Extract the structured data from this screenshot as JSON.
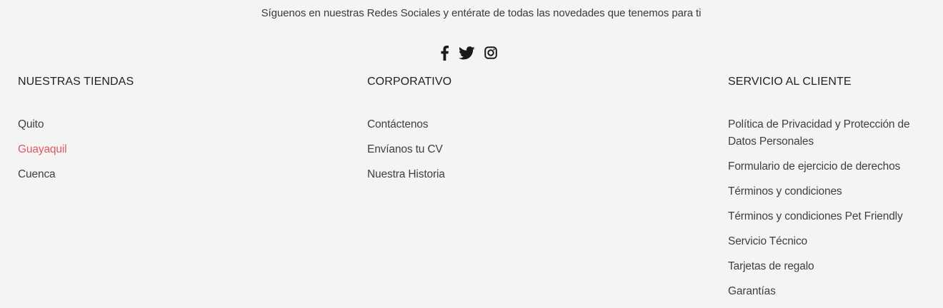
{
  "follow_text": "Síguenos en nuestras Redes Sociales y entérate de todas las novedades que tenemos para ti",
  "social": [
    {
      "icon": "facebook-icon"
    },
    {
      "icon": "twitter-icon"
    },
    {
      "icon": "instagram-icon"
    }
  ],
  "columns": {
    "tiendas": {
      "title": "NUESTRAS TIENDAS",
      "items": [
        "Quito",
        "Guayaquil",
        "Cuenca"
      ],
      "active_index": 1
    },
    "corporativo": {
      "title": "CORPORATIVO",
      "items": [
        "Contáctenos",
        "Envíanos tu CV",
        "Nuestra Historia"
      ]
    },
    "servicio": {
      "title": "SERVICIO AL CLIENTE",
      "items": [
        "Política de Privacidad y Protección de Datos Personales",
        "Formulario de ejercicio de derechos",
        "Términos y condiciones",
        "Términos y condiciones Pet Friendly",
        "Servicio Técnico",
        "Tarjetas de regalo",
        "Garantías"
      ]
    }
  },
  "colors": {
    "background": "#f4f4f4",
    "text": "#3f3f3f",
    "heading": "#222222",
    "active_link": "#e05a63",
    "icon": "#1a1a1a"
  }
}
